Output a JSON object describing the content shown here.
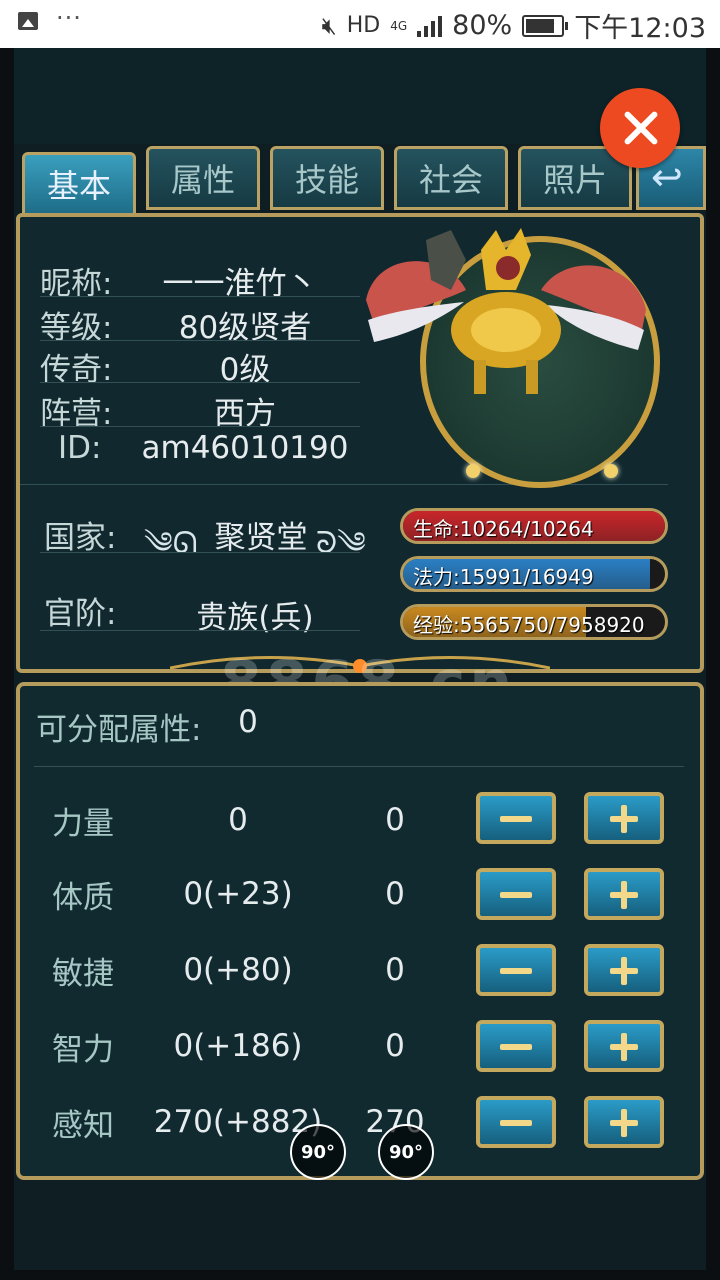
{
  "status_bar": {
    "dots": "···",
    "hd": "HD",
    "network": "4G",
    "battery_pct": "80%",
    "time": "下午12:03"
  },
  "tabs": [
    {
      "label": "基本",
      "active": true
    },
    {
      "label": "属性",
      "active": false
    },
    {
      "label": "技能",
      "active": false
    },
    {
      "label": "社会",
      "active": false
    },
    {
      "label": "照片",
      "active": false
    }
  ],
  "profile": {
    "nickname_label": "昵称:",
    "nickname": "一一淮竹丶",
    "level_label": "等级:",
    "level": "80级贤者",
    "legend_label": "传奇:",
    "legend": "0级",
    "camp_label": "阵营:",
    "camp": "西方",
    "id_label": "ID:",
    "id": "am46010190",
    "nation_label": "国家:",
    "nation": "聚贤堂",
    "rank_label": "官阶:",
    "rank": "贵族(兵)"
  },
  "bars": {
    "hp": {
      "text": "生命:10264/10264",
      "fraction": 1.0,
      "color": "#c8262a"
    },
    "mp": {
      "text": "法力:15991/16949",
      "fraction": 0.943,
      "color": "#2a7fc4"
    },
    "exp": {
      "text": "经验:5565750/7958920",
      "fraction": 0.699,
      "color": "#c9891f"
    }
  },
  "attributes": {
    "free_label": "可分配属性:",
    "free_value": "0",
    "rows": [
      {
        "label": "力量",
        "base": "0",
        "added": "0"
      },
      {
        "label": "体质",
        "base": "0(+23)",
        "added": "0"
      },
      {
        "label": "敏捷",
        "base": "0(+80)",
        "added": "0"
      },
      {
        "label": "智力",
        "base": "0(+186)",
        "added": "0"
      },
      {
        "label": "感知",
        "base": "270(+882)",
        "added": "270"
      }
    ]
  },
  "rotate": {
    "left": "90°",
    "right": "90°"
  },
  "watermark": "8868.cn"
}
